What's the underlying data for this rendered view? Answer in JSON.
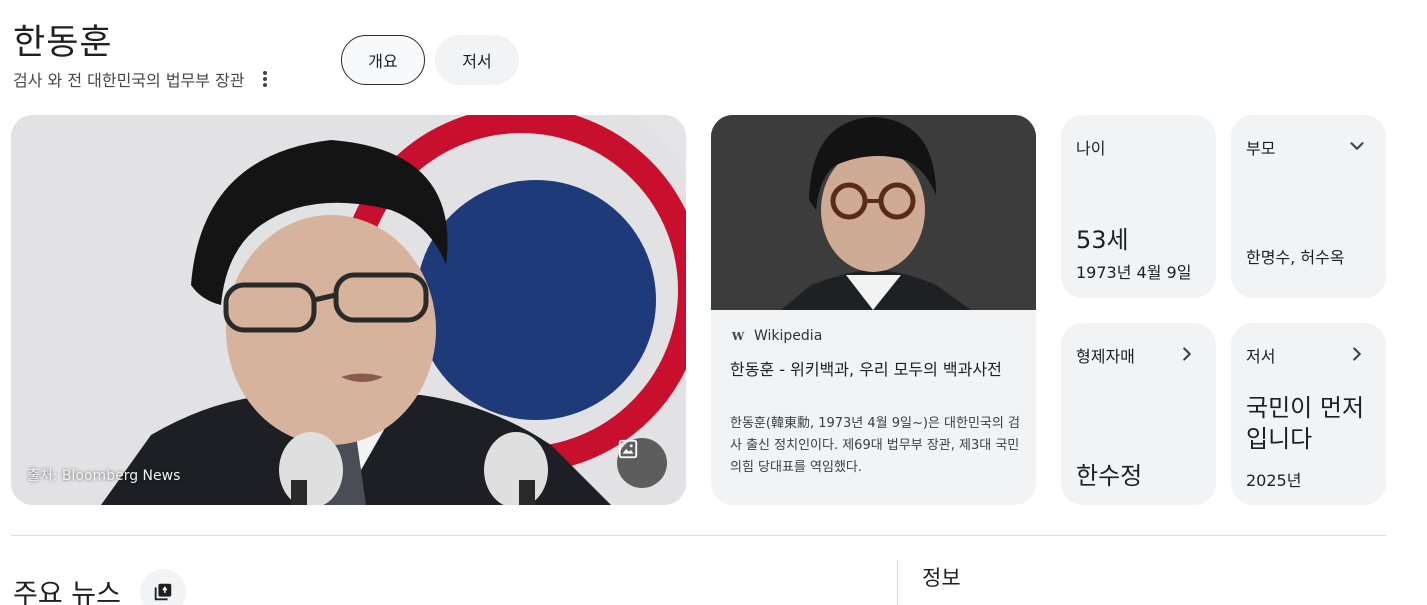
{
  "header": {
    "title": "한동훈",
    "subtitle": "검사 와 전 대한민국의 법무부 장관"
  },
  "tabs": [
    {
      "label": "개요",
      "active": true
    },
    {
      "label": "저서",
      "active": false
    }
  ],
  "hero": {
    "credit": "출처: Bloomberg News",
    "image_icon": "image-icon"
  },
  "wiki_card": {
    "source_logo": "W",
    "source": "Wikipedia",
    "title": "한동훈 - 위키백과, 우리 모두의 백과사전",
    "description": "한동훈(韓東勳, 1973년 4월 9일~)은 대한민국의 검사 출신 정치인이다. 제69대 법무부 장관, 제3대 국민의힘 당대표를 역임했다."
  },
  "facts": {
    "age": {
      "label": "나이",
      "value": "53세",
      "date": "1973년 4월 9일"
    },
    "parents": {
      "label": "부모",
      "value": "한명수, 허수옥",
      "icon": "chevron-down-icon"
    },
    "siblings": {
      "label": "형제자매",
      "value": "한수정",
      "icon": "chevron-right-icon"
    },
    "books": {
      "label": "저서",
      "value": "국민이 먼저입니다",
      "year": "2025년",
      "icon": "chevron-right-icon"
    }
  },
  "sections": {
    "news_heading": "주요 뉴스",
    "info_heading": "정보"
  },
  "colors": {
    "card_bg": "#f1f3f4",
    "text": "#1f1f1f",
    "divider": "#dadce0"
  }
}
